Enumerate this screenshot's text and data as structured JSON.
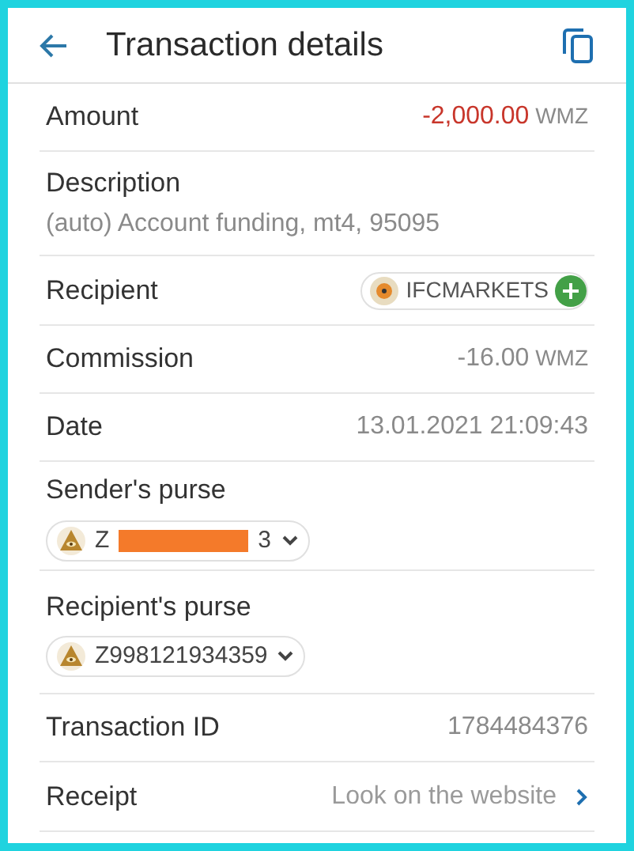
{
  "header": {
    "title": "Transaction details"
  },
  "rows": [
    {
      "kind": "pair",
      "label": "Amount",
      "value": "-2,000.00",
      "unit": "WMZ",
      "negative": true
    },
    {
      "kind": "stacked",
      "label": "Description",
      "value": "(auto) Account funding, mt4, 95095"
    },
    {
      "kind": "recipient",
      "label": "Recipient",
      "value": "IFCMARKETS"
    },
    {
      "kind": "pair",
      "label": "Commission",
      "value": "-16.00",
      "unit": "WMZ",
      "negative": false
    },
    {
      "kind": "pair",
      "label": "Date",
      "value": "13.01.2021 21:09:43"
    },
    {
      "kind": "purse",
      "label": "Sender's purse",
      "prefix": "Z",
      "suffix": "3",
      "redacted": true
    },
    {
      "kind": "purse",
      "label": "Recipient's purse",
      "prefix": "Z998121934359",
      "redacted": false
    },
    {
      "kind": "pair",
      "label": "Transaction ID",
      "value": "1784484376"
    },
    {
      "kind": "link",
      "label": "Receipt",
      "value": "Look on the website"
    }
  ]
}
